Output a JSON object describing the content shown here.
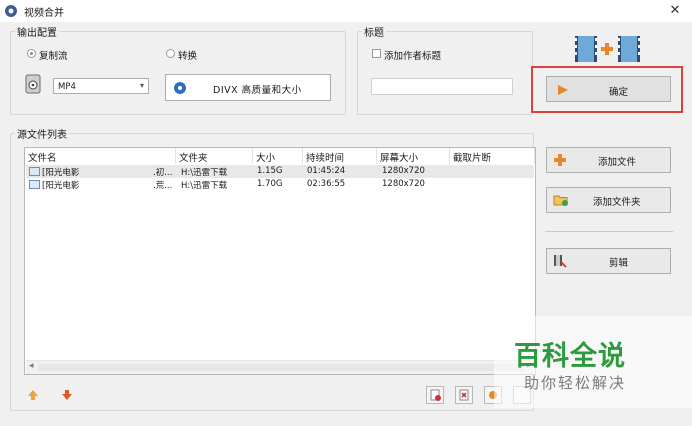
{
  "window": {
    "title": "视频合并",
    "close": "✕"
  },
  "output": {
    "group_label": "输出配置",
    "radio_copy": "复制流",
    "radio_convert": "转换",
    "format_value": "MP4",
    "format_arrow": "▾",
    "preset_label": "DIVX 高质量和大小"
  },
  "title_group": {
    "group_label": "标题",
    "checkbox_label": "添加作者标题",
    "input_value": ""
  },
  "confirm_button": "确定",
  "source": {
    "group_label": "源文件列表",
    "columns": [
      "文件名",
      "文件夹",
      "大小",
      "持续时间",
      "屏幕大小",
      "截取片断"
    ],
    "rows": [
      {
        "name": "[阳光电影",
        "name_tail": ".初...",
        "folder": "H:\\迅雷下载",
        "size": "1.15G",
        "duration": "01:45:24",
        "screen": "1280x720",
        "clip": ""
      },
      {
        "name": "[阳光电影",
        "name_tail": ".荒...",
        "folder": "H:\\迅雷下载",
        "size": "1.70G",
        "duration": "02:36:55",
        "screen": "1280x720",
        "clip": ""
      }
    ],
    "scroll_left": "◂",
    "scroll_right": "▸"
  },
  "side_buttons": {
    "add_file": "添加文件",
    "add_folder": "添加文件夹",
    "edit": "剪辑"
  },
  "watermark": {
    "line1": "百科全说",
    "line2": "助你轻松解决"
  },
  "colors": {
    "highlight_border": "#e0403a",
    "add_icon": "#e8862a",
    "watermark_green": "#2c9a3d"
  }
}
